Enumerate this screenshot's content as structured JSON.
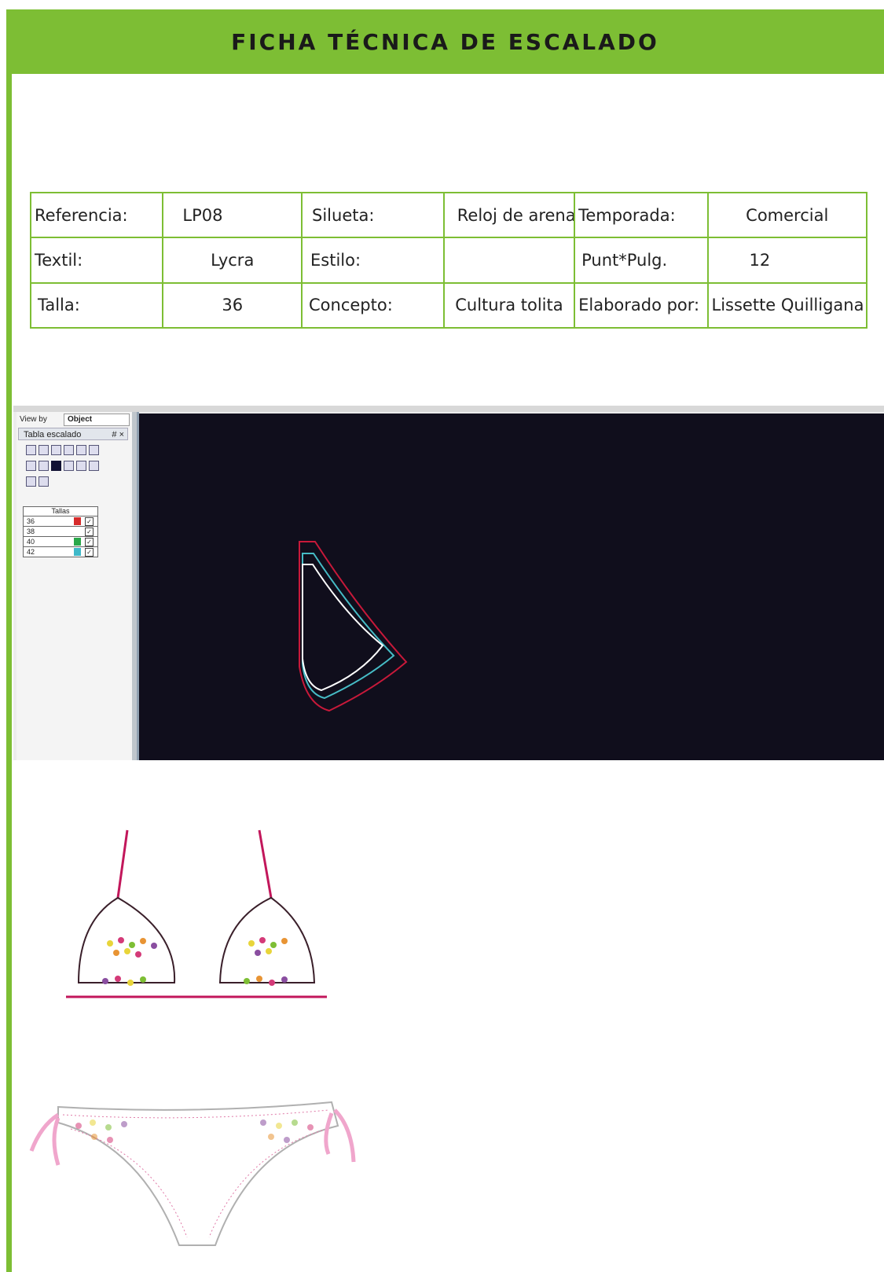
{
  "header": {
    "title": "FICHA TÉCNICA DE ESCALADO"
  },
  "spec_table": {
    "rows": [
      [
        "Referencia:",
        "LP08",
        "Silueta:",
        "Reloj de arena",
        "Temporada:",
        "Comercial"
      ],
      [
        "Textil:",
        "Lycra",
        "Estilo:",
        "",
        "Punt*Pulg.",
        "12"
      ],
      [
        "Talla:",
        "36",
        "Concepto:",
        "Cultura tolita",
        "Elaborado por:",
        "Lissette Quilligana"
      ]
    ]
  },
  "cad": {
    "view_by_label": "View by",
    "view_by_value": "Object",
    "panel_title": "Tabla escalado",
    "pin_close": "# ×",
    "sizes_header": "Tallas",
    "sizes": [
      {
        "label": "36",
        "color": "#d62b2b",
        "checked": true
      },
      {
        "label": "38",
        "color": "#ffffff",
        "checked": false
      },
      {
        "label": "40",
        "color": "#2aa84a",
        "checked": true
      },
      {
        "label": "42",
        "color": "#3fb9c9",
        "checked": true
      }
    ],
    "pattern_colors": {
      "outer": "#c8193a",
      "middle": "#46bcc6",
      "inner": "#ffffff"
    }
  },
  "illustration": {
    "colors": {
      "strap": "#c2175b",
      "outline": "#3a1f2a",
      "tie": "#f0a6cc",
      "stitch": "#e07aa8"
    },
    "dot_colors": [
      "#e8d53a",
      "#e89434",
      "#d43a78",
      "#8a4ea0",
      "#7dbe34"
    ]
  }
}
